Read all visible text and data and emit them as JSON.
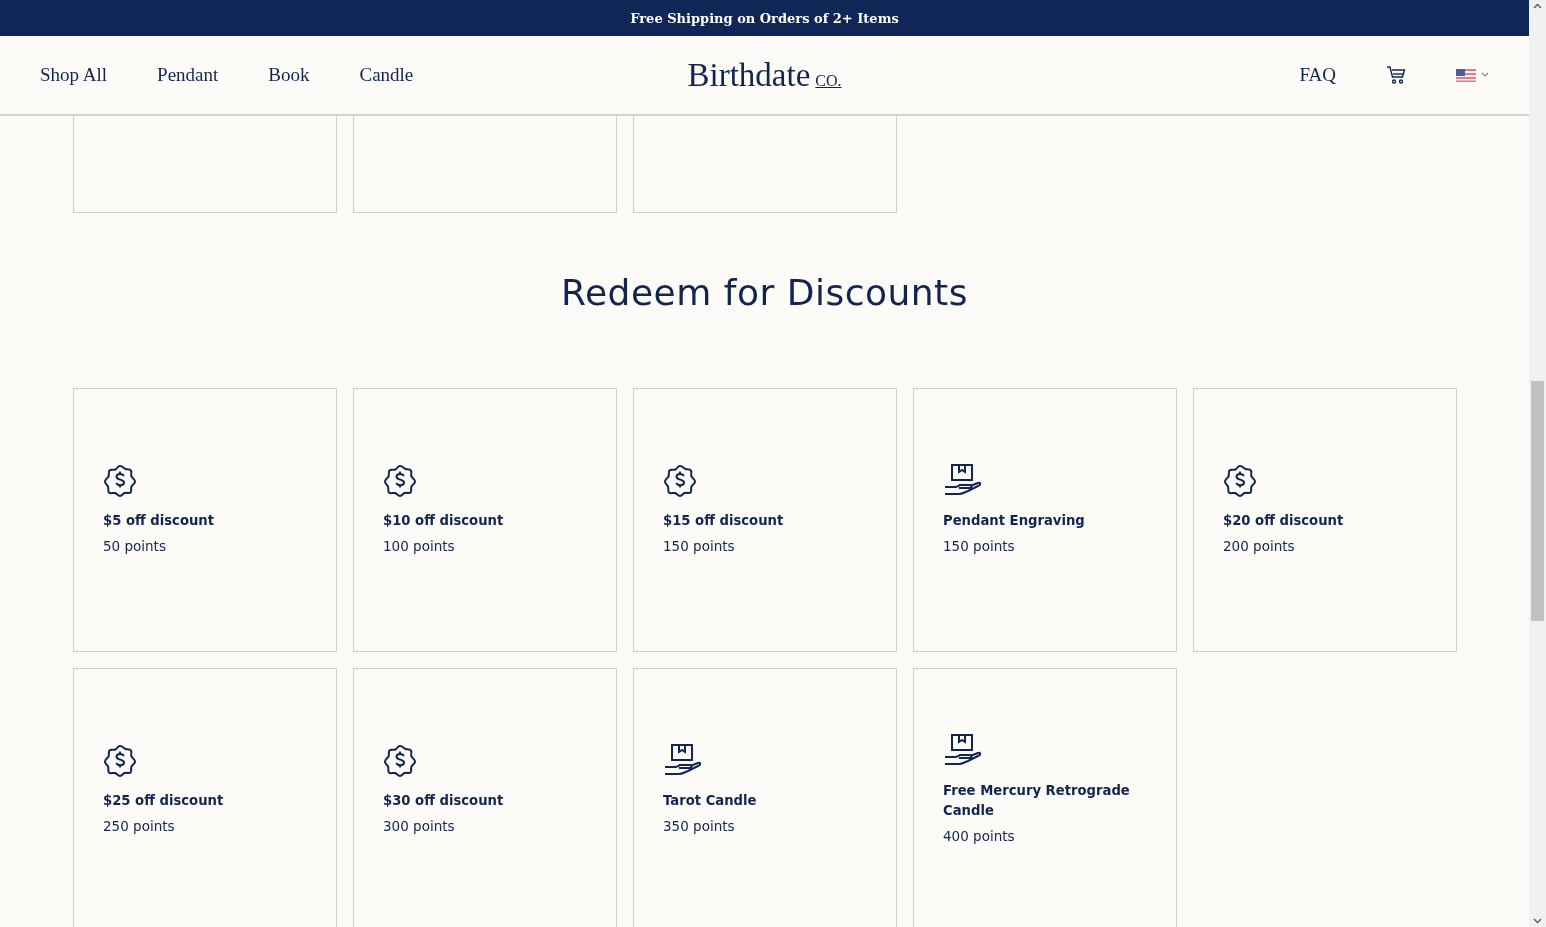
{
  "announcement": "Free Shipping on Orders of 2+ Items",
  "nav": {
    "links": [
      "Shop All",
      "Pendant",
      "Book",
      "Candle"
    ],
    "logo": "Birthdate",
    "logo_suffix": "CO.",
    "right_links": [
      "FAQ"
    ]
  },
  "top_cards": [
    {
      "kind": "reward"
    },
    {
      "kind": "reward"
    },
    {
      "kind": "reward"
    }
  ],
  "section": {
    "title": "Redeem for Discounts"
  },
  "rewards": [
    {
      "kind": "coupon",
      "title": "$5 off discount",
      "points": "50 points"
    },
    {
      "kind": "coupon",
      "title": "$10 off discount",
      "points": "100 points"
    },
    {
      "kind": "coupon",
      "title": "$15 off discount",
      "points": "150 points"
    },
    {
      "kind": "product",
      "title": "Pendant Engraving",
      "points": "150 points"
    },
    {
      "kind": "coupon",
      "title": "$20 off discount",
      "points": "200 points"
    },
    {
      "kind": "coupon",
      "title": "$25 off discount",
      "points": "250 points"
    },
    {
      "kind": "coupon",
      "title": "$30 off discount",
      "points": "300 points"
    },
    {
      "kind": "product",
      "title": "Tarot Candle",
      "points": "350 points"
    },
    {
      "kind": "product",
      "title": "Free Mercury Retrograde Candle",
      "points": "400 points"
    }
  ]
}
